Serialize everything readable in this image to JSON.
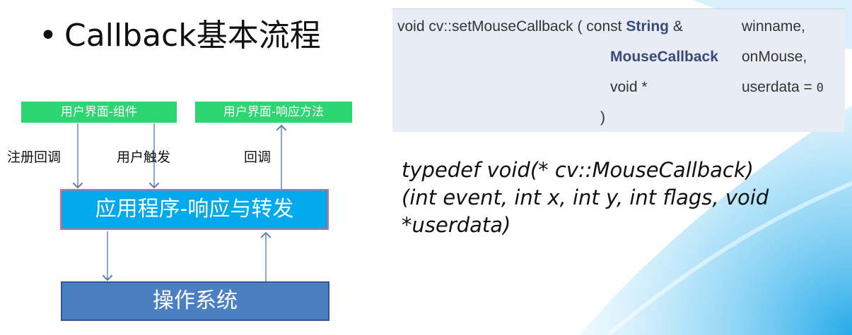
{
  "slide": {
    "bullet": "•",
    "title": "Callback基本流程"
  },
  "signature": {
    "prefix": "void cv::setMouseCallback ( const",
    "type1": "String",
    "amp": "&",
    "param1": "winname,",
    "type2": "MouseCallback",
    "param2": "onMouse,",
    "type3": "void *",
    "param3": "userdata =",
    "default": "0",
    "close": ")"
  },
  "typedef": {
    "line1": "typedef void(* cv::MouseCallback)",
    "line2": "(int event, int x, int y, int flags, void",
    "line3": "*userdata)"
  },
  "diagram": {
    "ui_component": "用户界面-组件",
    "ui_response": "用户界面-响应方法",
    "label_register": "注册回调",
    "label_trigger": "用户触发",
    "label_callback": "回调",
    "app": "应用程序-响应与转发",
    "os": "操作系统"
  },
  "colors": {
    "green_box": "#2ed573",
    "app_box": "#00a8ec",
    "app_border": "#ff5f7a",
    "os_box": "#4a7fc1",
    "arrow": "#5b7fb5"
  }
}
